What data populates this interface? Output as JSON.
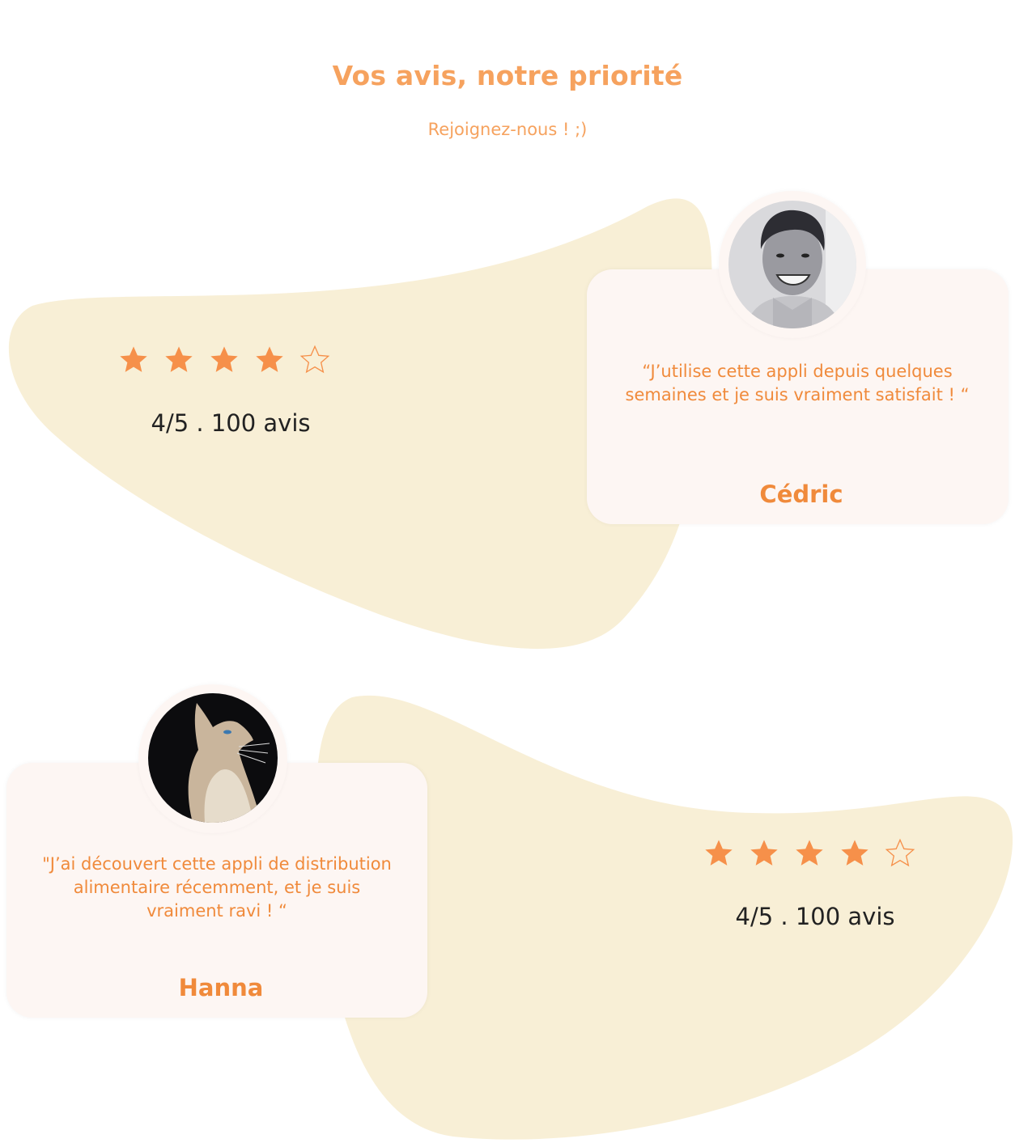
{
  "header": {
    "title": "Vos avis, notre priorité",
    "subtitle": "Rejoignez-nous ! ;)"
  },
  "colors": {
    "accent": "#f08a3b",
    "blob": "#f8efd6",
    "card": "#fdf6f3"
  },
  "reviews": [
    {
      "stars_filled": 4,
      "stars_total": 5,
      "rating_text": "4/5 . 100 avis",
      "quote_lines": [
        "“J’utilise cette appli depuis quelques",
        "semaines et je suis vraiment satisfait ! “"
      ],
      "author": "Cédric",
      "avatar": "man-portrait-photo"
    },
    {
      "stars_filled": 4,
      "stars_total": 5,
      "rating_text": "4/5 . 100 avis",
      "quote_lines": [
        "\"J’ai découvert cette appli de distribution",
        "alimentaire récemment, et je suis",
        "vraiment ravi ! “"
      ],
      "author": "Hanna",
      "avatar": "cat-portrait-photo"
    }
  ]
}
